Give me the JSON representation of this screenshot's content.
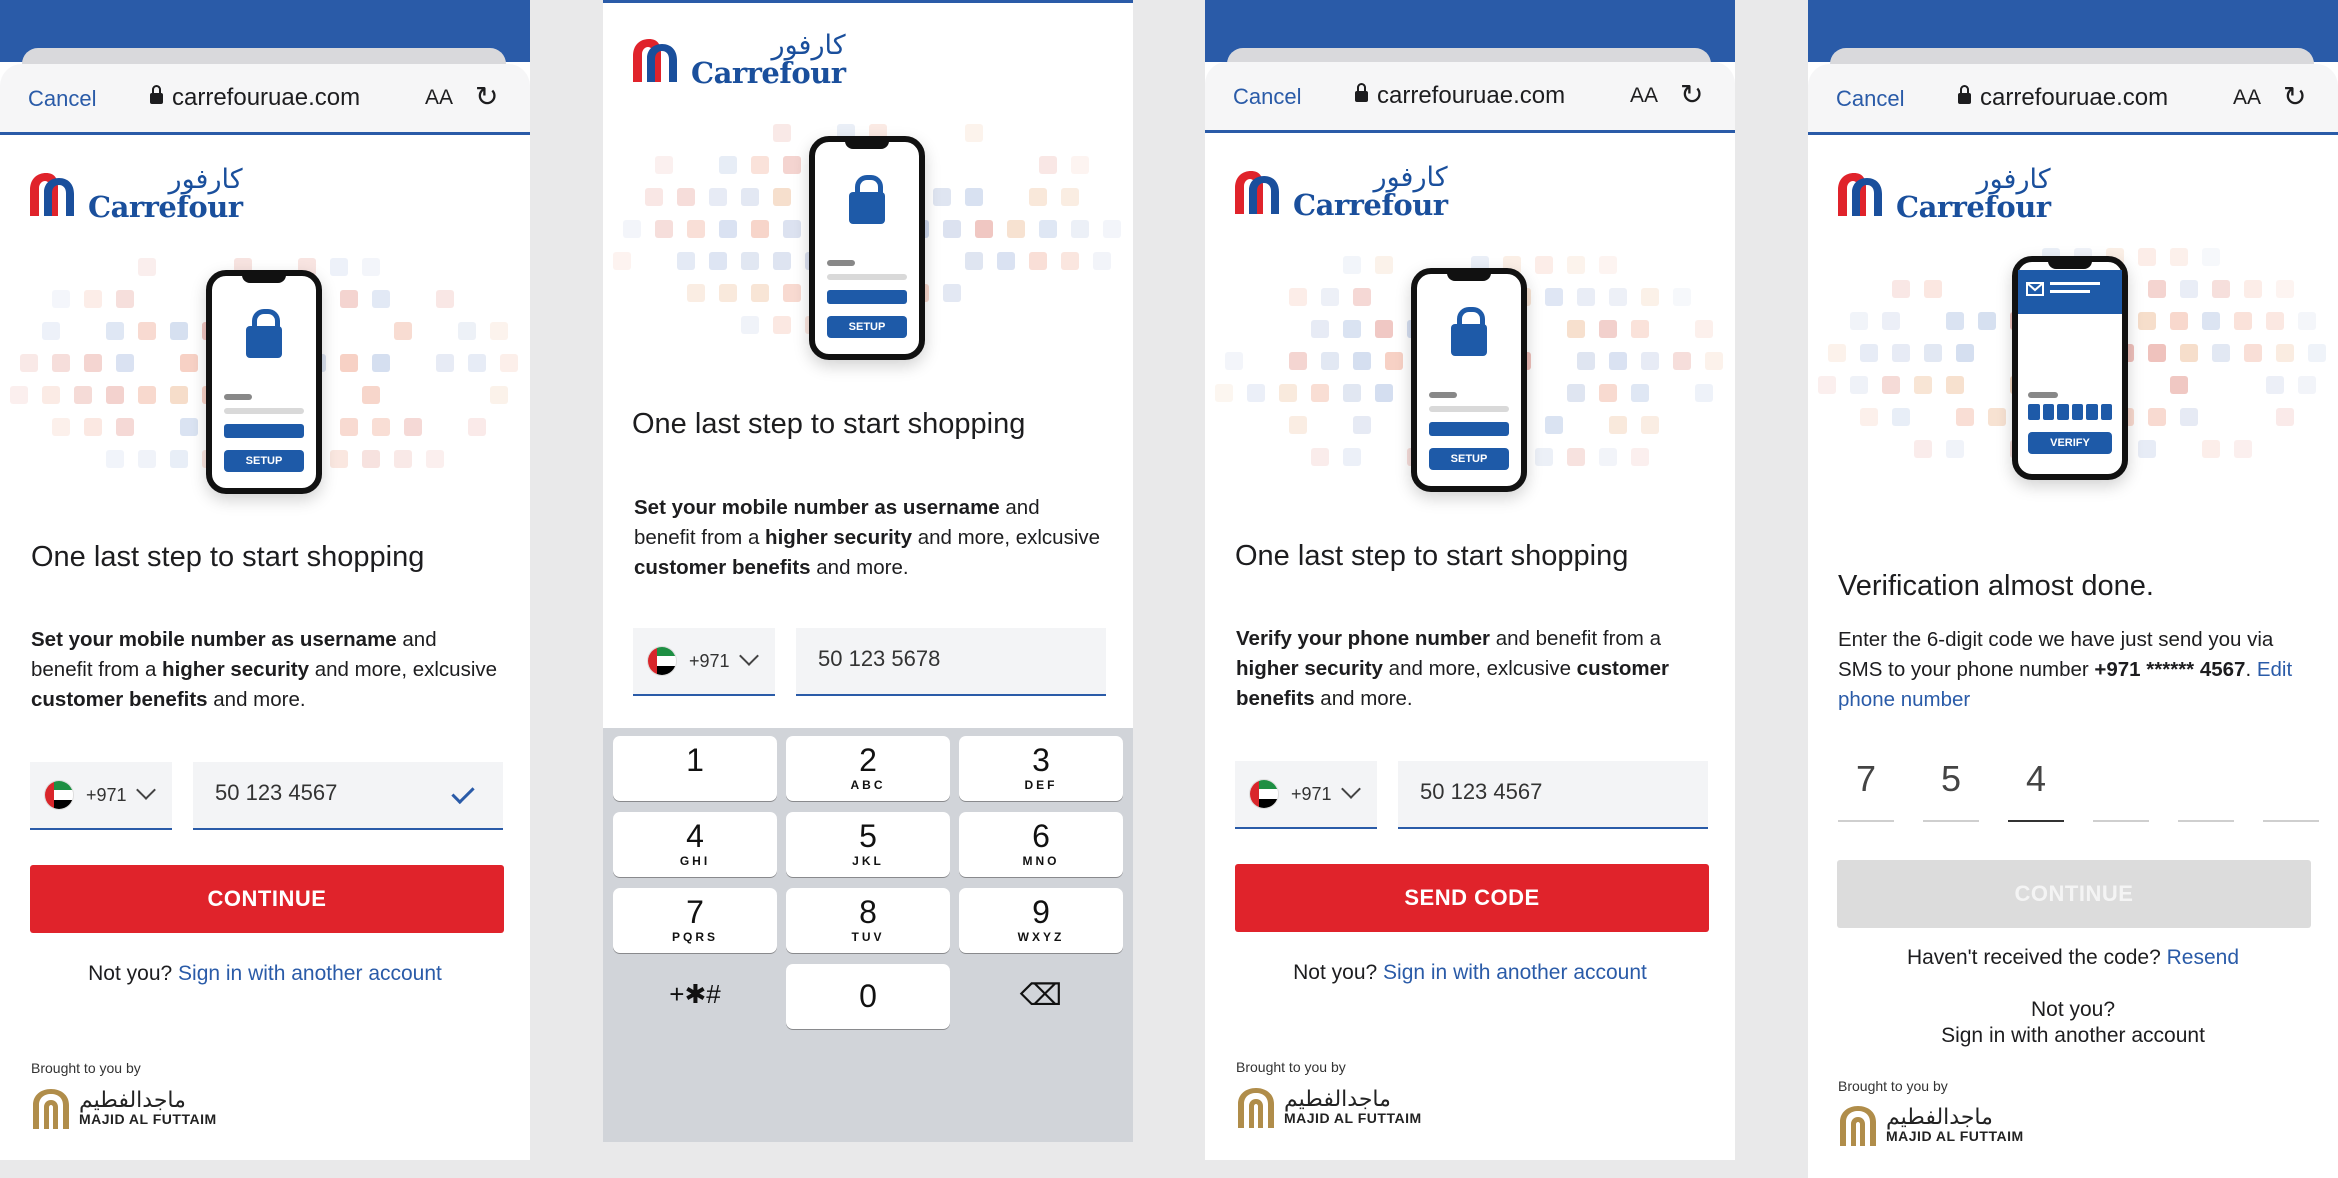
{
  "browser": {
    "cancel": "Cancel",
    "url": "carrefouruae.com",
    "text_size": "AA",
    "reload": "↻"
  },
  "brand": {
    "arabic": "كارفور",
    "name": "Carrefour"
  },
  "setup_label": "SETUP",
  "verify_label": "VERIFY",
  "title": "One last step to start shopping",
  "intro1": {
    "b1": "Set your mobile number as username",
    "t1": " and benefit from a ",
    "b2": "higher security",
    "t2": " and more, exlcusive ",
    "b3": "customer benefits",
    "t3": " and more."
  },
  "intro3": {
    "b1": "Verify your phone number",
    "t1": " and benefit from a ",
    "b2": "higher security",
    "t2": " and more, exlcusive ",
    "b3": "customer benefits",
    "t3": " and more."
  },
  "country_code": "+971",
  "phone_values": {
    "screen1": "50 123 4567",
    "screen2": "50 123 5678",
    "screen3": "50 123 4567"
  },
  "buttons": {
    "continue": "CONTINUE",
    "send_code": "SEND CODE"
  },
  "not_you": "Not you?",
  "sign_in_other": "Sign in with another account",
  "brought_by": "Brought to you by",
  "maf": {
    "arabic": "ماجدالفطيم",
    "name": "MAJID AL FUTTAIM"
  },
  "keypad": [
    {
      "n": "1",
      "l": ""
    },
    {
      "n": "2",
      "l": "ABC"
    },
    {
      "n": "3",
      "l": "DEF"
    },
    {
      "n": "4",
      "l": "GHI"
    },
    {
      "n": "5",
      "l": "JKL"
    },
    {
      "n": "6",
      "l": "MNO"
    },
    {
      "n": "7",
      "l": "PQRS"
    },
    {
      "n": "8",
      "l": "TUV"
    },
    {
      "n": "9",
      "l": "WXYZ"
    },
    {
      "n": "+✱#",
      "l": ""
    },
    {
      "n": "0",
      "l": ""
    },
    {
      "n": "⌫",
      "l": ""
    }
  ],
  "verification": {
    "title": "Verification almost done.",
    "text": "Enter the 6-digit code we have just send you via SMS to your phone number",
    "masked": "+971 ****** 4567",
    "sep": ".",
    "edit": "Edit phone number",
    "digits": [
      "7",
      "5",
      "4",
      "",
      "",
      ""
    ],
    "not_received": "Haven't received the code?",
    "resend": "Resend"
  }
}
